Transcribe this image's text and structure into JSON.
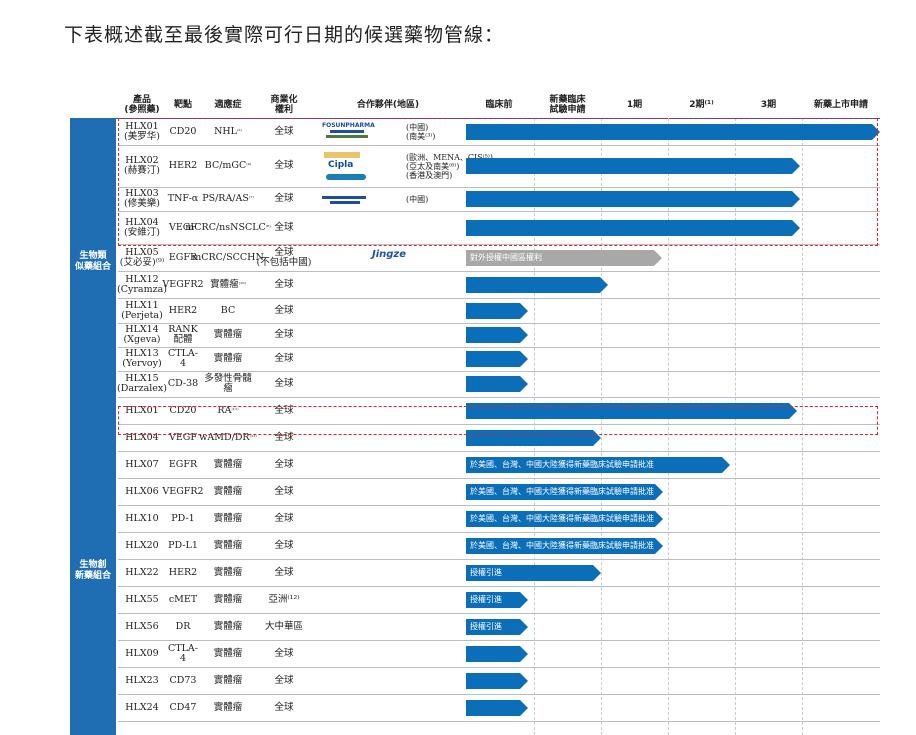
{
  "title": "下表概述截至最後實際可行日期的候選藥物管線：",
  "headers": {
    "product": "產品\n(參照藥)",
    "target": "靶點",
    "indication": "適應症",
    "rights": "商業化\n權利",
    "partner": "合作夥伴(地區)",
    "preclinical": "臨床前",
    "ind": "新藥臨床\n試驗申請",
    "p1": "1期",
    "p2": "2期⁽¹⁾",
    "p3": "3期",
    "nda": "新藥上市申請"
  },
  "groups": {
    "biosimilar": "生物類\n似藥組合",
    "innovative": "生物創\n新藥組合"
  },
  "partner_logos": {
    "fosun": "FOSUNPHARMA",
    "cipla": "Cipla",
    "jingze": "Jingze"
  },
  "rows": [
    {
      "product": "HLX01\n(美罗华)",
      "target": "CD20",
      "indication": "NHL",
      "ind_sup": "⁽²⁾",
      "rights": "全球",
      "partner": "(中國)\n(南美⁽³⁾)",
      "bar": "full"
    },
    {
      "product": "HLX02\n(赫賽汀)",
      "target": "HER2",
      "indication": "BC/mGC",
      "ind_sup": "⁽⁴⁾",
      "rights": "全球",
      "partner": "(歐洲、MENA、CIS⁽⁵⁾)\n(亞太及南美⁽⁶⁾)\n(香港及澳門)",
      "bar": "nda"
    },
    {
      "product": "HLX03\n(修美樂)",
      "target": "TNF-α",
      "indication": "PS/RA/AS",
      "ind_sup": "⁽⁷⁾",
      "rights": "全球",
      "partner": "(中國)",
      "bar": "nda"
    },
    {
      "product": "HLX04\n(安維汀)",
      "target": "VEGF",
      "indication": "mCRC/nsNSCLC",
      "ind_sup": "⁽⁸⁾",
      "rights": "全球",
      "partner": "",
      "bar": "nda"
    },
    {
      "product": "HLX05\n(艾必妥)⁽⁹⁾",
      "target": "EGFR",
      "indication": "mCRC/SCCHN",
      "ind_sup": "",
      "rights": "全球\n(不包括中國)",
      "partner": "",
      "bar": "license",
      "bar_label": "對外授權中國區權利"
    },
    {
      "product": "HLX12\n(Cyramza)",
      "target": "VEGFR2",
      "indication": "實體瘤",
      "ind_sup": "⁽¹⁰⁾",
      "rights": "全球",
      "partner": "",
      "bar": "p1"
    },
    {
      "product": "HLX11\n(Perjeta)",
      "target": "HER2",
      "indication": "BC",
      "ind_sup": "",
      "rights": "全球",
      "partner": "",
      "bar": "pre"
    },
    {
      "product": "HLX14\n(Xgeva)",
      "target": "RANK\n配體",
      "indication": "實體瘤",
      "ind_sup": "",
      "rights": "全球",
      "partner": "",
      "bar": "pre"
    },
    {
      "product": "HLX13\n(Yervoy)",
      "target": "CTLA-4",
      "indication": "實體瘤",
      "ind_sup": "",
      "rights": "全球",
      "partner": "",
      "bar": "pre"
    },
    {
      "product": "HLX15\n(Darzalex)",
      "target": "CD-38",
      "indication": "多發性骨髓瘤",
      "ind_sup": "",
      "rights": "全球",
      "partner": "",
      "bar": "pre"
    },
    {
      "product": "HLX01",
      "target": "CD20",
      "indication": "RA",
      "ind_sup": "⁽¹¹⁾",
      "rights": "全球",
      "partner": "",
      "bar": "p3"
    },
    {
      "product": "HLX04",
      "target": "VEGF",
      "indication": "wAMD/DR",
      "ind_sup": "⁽¹¹⁾",
      "rights": "全球",
      "partner": "",
      "bar": "ind"
    },
    {
      "product": "HLX07",
      "target": "EGFR",
      "indication": "實體瘤",
      "ind_sup": "",
      "rights": "全球",
      "partner": "",
      "bar": "p2",
      "bar_label": "於美國、台灣、中國大陸獲得新藥臨床試驗申請批准"
    },
    {
      "product": "HLX06",
      "target": "VEGFR2",
      "indication": "實體瘤",
      "ind_sup": "",
      "rights": "全球",
      "partner": "",
      "bar": "ind_long",
      "bar_label": "於美國、台灣、中國大陸獲得新藥臨床試驗申請批准"
    },
    {
      "product": "HLX10",
      "target": "PD-1",
      "indication": "實體瘤",
      "ind_sup": "",
      "rights": "全球",
      "partner": "",
      "bar": "ind_long",
      "bar_label": "於美國、台灣、中國大陸獲得新藥臨床試驗申請批准"
    },
    {
      "product": "HLX20",
      "target": "PD-L1",
      "indication": "實體瘤",
      "ind_sup": "",
      "rights": "全球",
      "partner": "",
      "bar": "ind_long",
      "bar_label": "於美國、台灣、中國大陸獲得新藥臨床試驗申請批准"
    },
    {
      "product": "HLX22",
      "target": "HER2",
      "indication": "實體瘤",
      "ind_sup": "",
      "rights": "全球",
      "partner": "",
      "bar": "ind",
      "bar_label": "授權引進"
    },
    {
      "product": "HLX55",
      "target": "cMET",
      "indication": "實體瘤",
      "ind_sup": "",
      "rights": "亞洲⁽¹²⁾",
      "partner": "",
      "bar": "pre",
      "bar_label": "授權引進"
    },
    {
      "product": "HLX56",
      "target": "DR",
      "indication": "實體瘤",
      "ind_sup": "",
      "rights": "大中華區",
      "partner": "",
      "bar": "pre",
      "bar_label": "授權引進"
    },
    {
      "product": "HLX09",
      "target": "CTLA-4",
      "indication": "實體瘤",
      "ind_sup": "",
      "rights": "全球",
      "partner": "",
      "bar": "pre"
    },
    {
      "product": "HLX23",
      "target": "CD73",
      "indication": "實體瘤",
      "ind_sup": "",
      "rights": "全球",
      "partner": "",
      "bar": "pre"
    },
    {
      "product": "HLX24",
      "target": "CD47",
      "indication": "實體瘤",
      "ind_sup": "",
      "rights": "全球",
      "partner": "",
      "bar": "pre"
    }
  ],
  "colors": {
    "bar": "#0a6fb8",
    "license": "#a8a8a8",
    "group": "#1f6db3",
    "highlight": "#d9252b"
  }
}
